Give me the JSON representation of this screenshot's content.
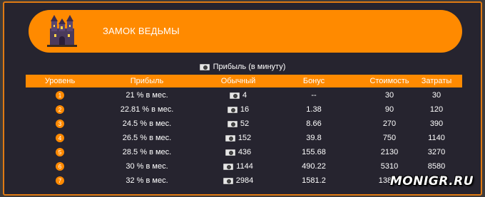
{
  "banner": {
    "title": "ЗАМОК ВЕДЬМЫ"
  },
  "subheading": "Прибыль (в минуту)",
  "columns": [
    "Уровень",
    "Прибыль",
    "Обычный",
    "Бонус",
    "Стоимость",
    "Затраты"
  ],
  "rows": [
    {
      "level": "1",
      "profit": "21 % в мес.",
      "regular": "4",
      "bonus": "--",
      "cost": "30",
      "spent": "30"
    },
    {
      "level": "2",
      "profit": "22.81 % в мес.",
      "regular": "16",
      "bonus": "1.38",
      "cost": "90",
      "spent": "120"
    },
    {
      "level": "3",
      "profit": "24.5 % в мес.",
      "regular": "52",
      "bonus": "8.66",
      "cost": "270",
      "spent": "390"
    },
    {
      "level": "4",
      "profit": "26.5 % в мес.",
      "regular": "152",
      "bonus": "39.8",
      "cost": "750",
      "spent": "1140"
    },
    {
      "level": "5",
      "profit": "28.5 % в мес.",
      "regular": "436",
      "bonus": "155.68",
      "cost": "2130",
      "spent": "3270"
    },
    {
      "level": "6",
      "profit": "30 % в мес.",
      "regular": "1144",
      "bonus": "490.22",
      "cost": "5310",
      "spent": "8580"
    },
    {
      "level": "7",
      "profit": "32 % в мес.",
      "regular": "2984",
      "bonus": "1581.2",
      "cost": "13890",
      "spent": "22470"
    }
  ],
  "watermark": "MONIGR.RU",
  "colors": {
    "accent": "#ff8a00",
    "panel": "#26242f",
    "border": "#e07a12"
  }
}
